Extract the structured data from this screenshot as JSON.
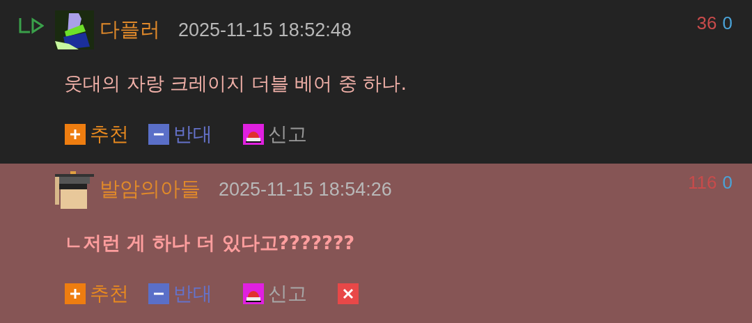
{
  "comments": [
    {
      "reply": true,
      "highlighted": false,
      "author": "다플러",
      "date": "2025-11-15 18:52:48",
      "upvotes": "36",
      "downvotes": "0",
      "text": "웃대의 자랑 크레이지 더블 베어 중 하나.",
      "actions": {
        "recommend": "추천",
        "oppose": "반대",
        "report": "신고"
      },
      "deletable": false
    },
    {
      "reply": false,
      "highlighted": true,
      "author": "발암의아들",
      "date": "2025-11-15 18:54:26",
      "upvotes": "116",
      "downvotes": "0",
      "text": "ㄴ저런 게 하나 더 있다고???????",
      "actions": {
        "recommend": "추천",
        "oppose": "반대",
        "report": "신고"
      },
      "deletable": true
    }
  ]
}
